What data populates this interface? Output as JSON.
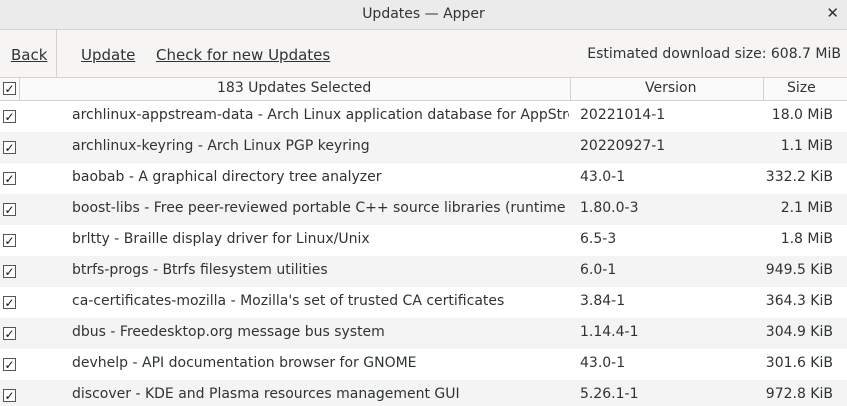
{
  "window": {
    "title": "Updates — Apper",
    "close_glyph": "✕"
  },
  "toolbar": {
    "back_label": "Back",
    "update_label": "Update",
    "check_label": "Check for new Updates",
    "download_size": "Estimated download size: 608.7 MiB"
  },
  "header": {
    "selected": "183 Updates Selected",
    "version": "Version",
    "size": "Size"
  },
  "rows": [
    {
      "name": "archlinux-appstream-data",
      "desc": " - Arch Linux application database for AppStream-based software centers",
      "version": "20221014-1",
      "size": "18.0 MiB"
    },
    {
      "name": "archlinux-keyring",
      "desc": " - Arch Linux PGP keyring",
      "version": "20220927-1",
      "size": "1.1 MiB"
    },
    {
      "name": "baobab",
      "desc": " - A graphical directory tree analyzer",
      "version": "43.0-1",
      "size": "332.2 KiB"
    },
    {
      "name": "boost-libs",
      "desc": " - Free peer-reviewed portable C++ source libraries (runtime libraries)",
      "version": "1.80.0-3",
      "size": "2.1 MiB"
    },
    {
      "name": "brltty",
      "desc": " - Braille display driver for Linux/Unix",
      "version": "6.5-3",
      "size": "1.8 MiB"
    },
    {
      "name": "btrfs-progs",
      "desc": " - Btrfs filesystem utilities",
      "version": "6.0-1",
      "size": "949.5 KiB"
    },
    {
      "name": "ca-certificates-mozilla",
      "desc": " - Mozilla's set of trusted CA certificates",
      "version": "3.84-1",
      "size": "364.3 KiB"
    },
    {
      "name": "dbus",
      "desc": " - Freedesktop.org message bus system",
      "version": "1.14.4-1",
      "size": "304.9 KiB"
    },
    {
      "name": "devhelp",
      "desc": " - API documentation browser for GNOME",
      "version": "43.0-1",
      "size": "301.6 KiB"
    },
    {
      "name": "discover",
      "desc": " - KDE and Plasma resources management GUI",
      "version": "5.26.1-1",
      "size": "972.8 KiB"
    }
  ]
}
